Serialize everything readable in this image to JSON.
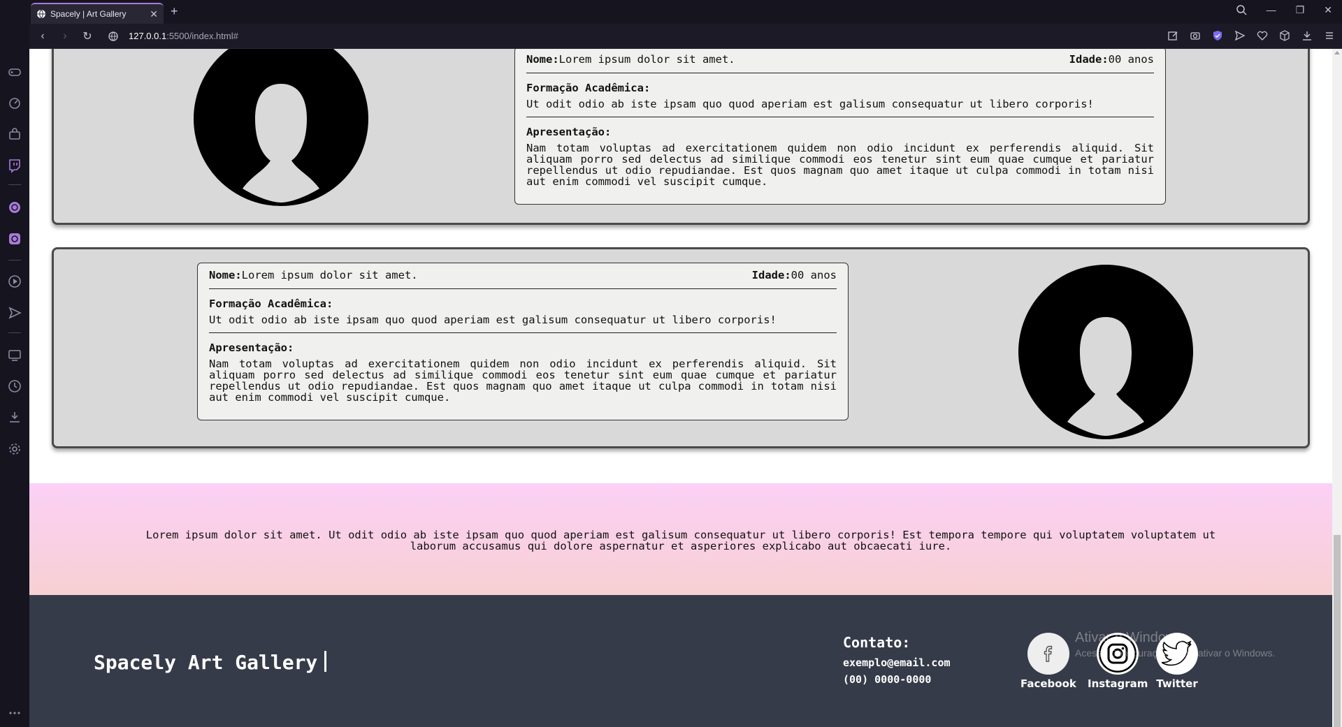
{
  "browser": {
    "tab_title": "Spacely | Art Gallery",
    "url_host": "127.0.0.1",
    "url_path": ":5500/index.html#"
  },
  "cards": [
    {
      "name_label": "Nome:",
      "name_value": "Lorem ipsum dolor sit amet.",
      "age_label": "Idade:",
      "age_value": "00 anos",
      "education_title": "Formação Acadêmica:",
      "education_text": "Ut odit odio ab iste ipsam quo quod aperiam est galisum consequatur ut libero corporis!",
      "presentation_title": "Apresentação:",
      "presentation_text": "Nam totam voluptas ad exercitationem quidem non odio incidunt ex perferendis aliquid. Sit aliquam porro sed delectus ad similique commodi eos tenetur sint eum quae cumque et pariatur repellendus ut odio repudiandae. Est quos magnam quo amet itaque ut culpa commodi in totam nisi aut enim commodi vel suscipit cumque."
    },
    {
      "name_label": "Nome:",
      "name_value": "Lorem ipsum dolor sit amet.",
      "age_label": "Idade:",
      "age_value": "00 anos",
      "education_title": "Formação Acadêmica:",
      "education_text": "Ut odit odio ab iste ipsam quo quod aperiam est galisum consequatur ut libero corporis!",
      "presentation_title": "Apresentação:",
      "presentation_text": "Nam totam voluptas ad exercitationem quidem non odio incidunt ex perferendis aliquid. Sit aliquam porro sed delectus ad similique commodi eos tenetur sint eum quae cumque et pariatur repellendus ut odio repudiandae. Est quos magnam quo amet itaque ut culpa commodi in totam nisi aut enim commodi vel suscipit cumque."
    }
  ],
  "banner_text": "Lorem ipsum dolor sit amet. Ut odit odio ab iste ipsam quo quod aperiam est galisum consequatur ut libero corporis! Est tempora tempore qui voluptatem voluptatem ut laborum accusamus qui dolore aspernatur et asperiores explicabo aut obcaecati iure.",
  "footer": {
    "brand": "Spacely Art Gallery",
    "contact_title": "Contato:",
    "email": "exemplo@email.com",
    "phone": "(00) 0000-0000",
    "social": [
      {
        "label": "Facebook",
        "icon": "facebook-icon"
      },
      {
        "label": "Instagram",
        "icon": "instagram-icon"
      },
      {
        "label": "Twitter",
        "icon": "twitter-icon"
      }
    ]
  },
  "windows_watermark": {
    "title": "Ativar o Windows",
    "subtitle": "Acesse Configurações para ativar o Windows."
  },
  "colors": {
    "card_bg": "#d9d9d9",
    "info_bg": "#f0f0ee",
    "banner_gradient_top": "#fbd0f6",
    "banner_gradient_bottom": "#f7d0d3",
    "footer_bg": "#363b49",
    "browser_accent": "#a77bd9"
  }
}
